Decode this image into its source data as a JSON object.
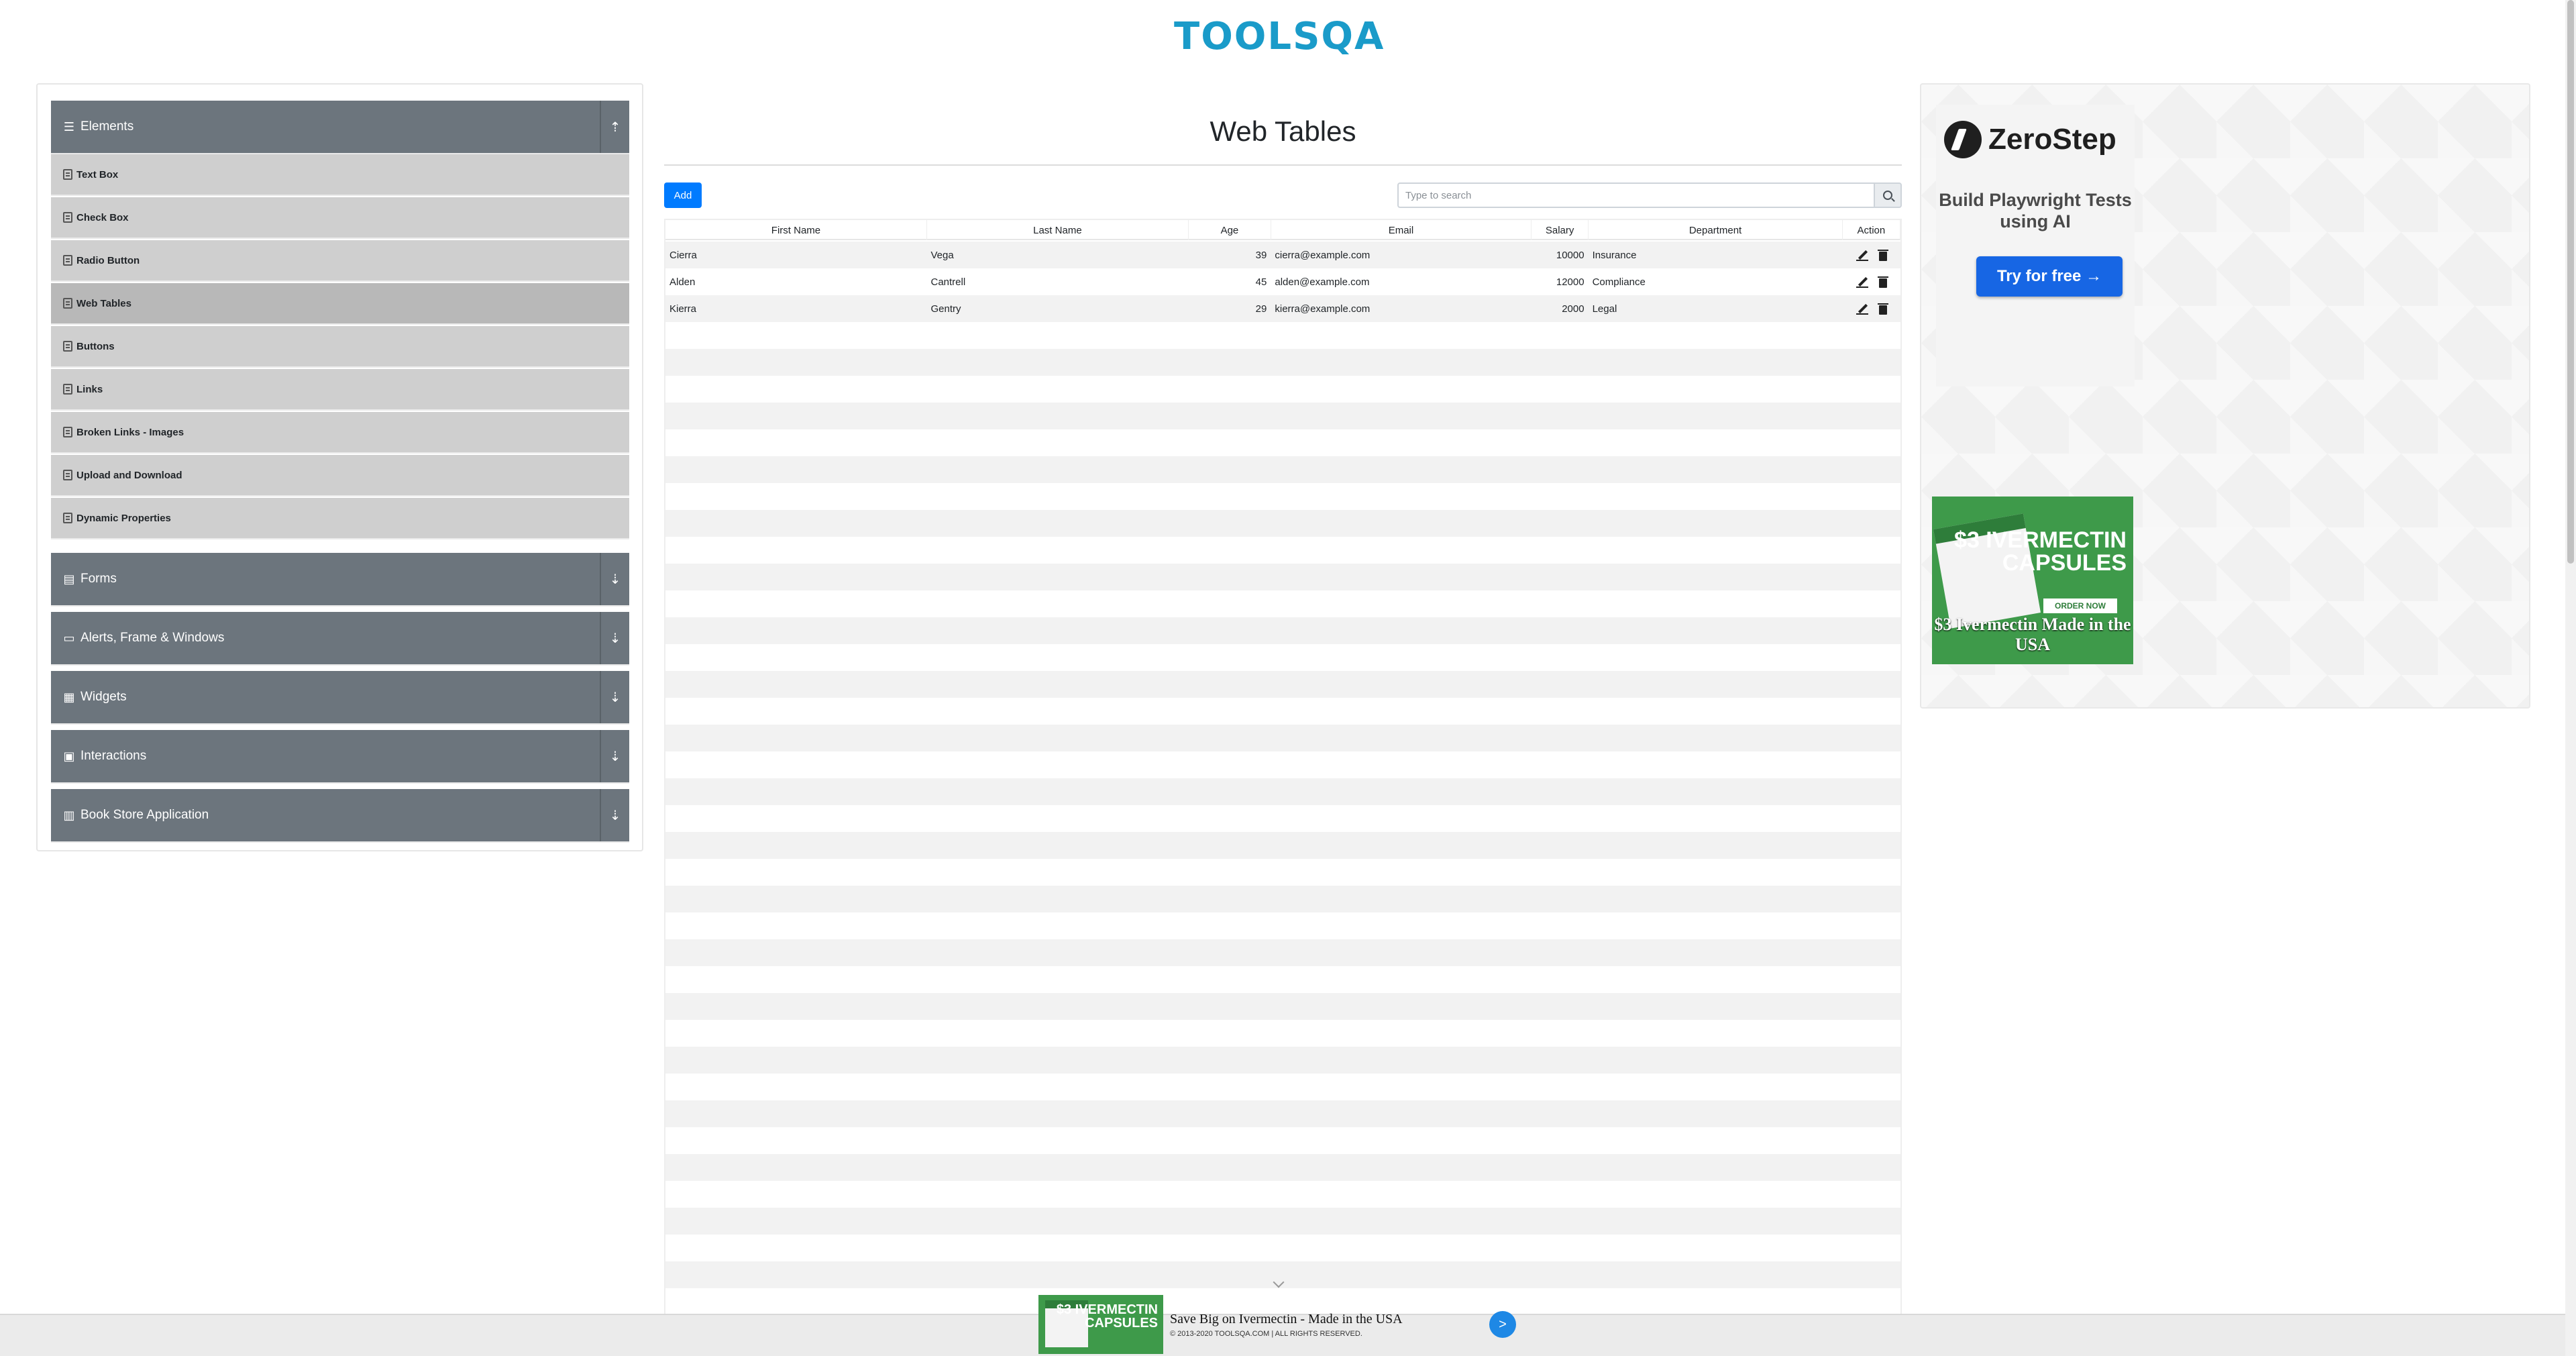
{
  "header": {
    "logo_text": "TOOLSQA"
  },
  "sidebar": {
    "groups": [
      {
        "label": "Elements",
        "icon": "list-icon",
        "expanded": true
      },
      {
        "label": "Forms",
        "icon": "form-icon"
      },
      {
        "label": "Alerts, Frame & Windows",
        "icon": "window-icon"
      },
      {
        "label": "Widgets",
        "icon": "grid-icon"
      },
      {
        "label": "Interactions",
        "icon": "interaction-icon"
      },
      {
        "label": "Book Store Application",
        "icon": "book-icon"
      }
    ],
    "element_items": [
      {
        "label": "Text Box"
      },
      {
        "label": "Check Box"
      },
      {
        "label": "Radio Button"
      },
      {
        "label": "Web Tables",
        "active": true
      },
      {
        "label": "Buttons"
      },
      {
        "label": "Links"
      },
      {
        "label": "Broken Links - Images"
      },
      {
        "label": "Upload and Download"
      },
      {
        "label": "Dynamic Properties"
      }
    ]
  },
  "main": {
    "title": "Web Tables",
    "add_label": "Add",
    "search_placeholder": "Type to search",
    "table": {
      "columns": [
        "First Name",
        "Last Name",
        "Age",
        "Email",
        "Salary",
        "Department",
        "Action"
      ],
      "rows": [
        [
          "Cierra",
          "Vega",
          "39",
          "cierra@example.com",
          "10000",
          "Insurance"
        ],
        [
          "Alden",
          "Cantrell",
          "45",
          "alden@example.com",
          "12000",
          "Compliance"
        ],
        [
          "Kierra",
          "Gentry",
          "29",
          "kierra@example.com",
          "2000",
          "Legal"
        ]
      ],
      "empty_rows": 37
    }
  },
  "ads": {
    "zerostep": {
      "brand": "ZeroStep",
      "tagline": "Build Playwright Tests using AI",
      "cta": "Try for free →"
    },
    "ivermectin": {
      "headline": "$3 IVERMECTIN CAPSULES",
      "order": "ORDER NOW",
      "caption": "$3 Ivermectin Made in the USA"
    },
    "bottom": {
      "title": "Save Big on Ivermectin - Made in the USA",
      "copyright": "© 2013-2020 TOOLSQA.COM | ALL RIGHTS RESERVED.",
      "mini_text": "$3 IVERMECTIN CAPSULES",
      "arrow": ">"
    }
  },
  "colors": {
    "primary": "#007bff",
    "sidebar_header": "#6c757d",
    "menu_item": "#cfcfcf",
    "logo_blue": "#1a9bc9"
  }
}
